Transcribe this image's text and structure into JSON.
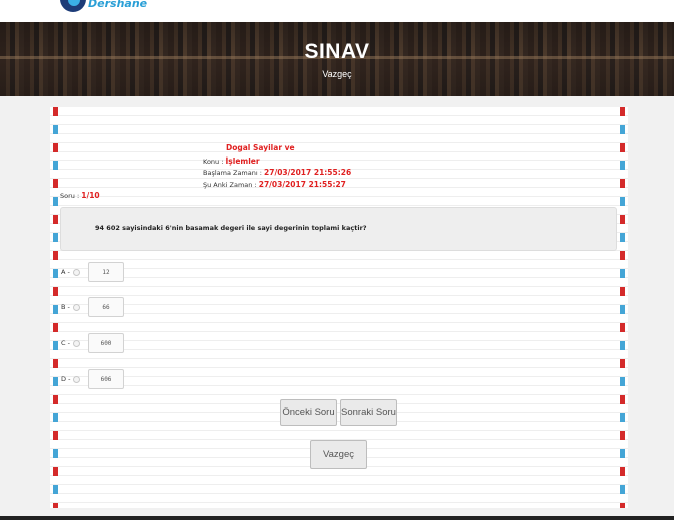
{
  "header": {
    "logo_text": "Dershane"
  },
  "hero": {
    "title": "SINAV",
    "subtitle": "Vazgeç"
  },
  "exam": {
    "topic_line": "Dogal Sayilar ve",
    "konu_label": "Konu :",
    "konu_value": "İşlemler",
    "start_label": "Başlama Zamanı :",
    "start_value": "27/03/2017 21:55:26",
    "now_label": "Şu Anki Zaman :",
    "now_value": "27/03/2017 21:55:27",
    "counter_label": "Soru :",
    "counter_value": "1/10"
  },
  "question": {
    "text": "94 602 sayisindaki 6'nin basamak degeri ile sayi degerinin toplami kaçtir?"
  },
  "options": [
    {
      "letter": "A -",
      "value": "12"
    },
    {
      "letter": "B -",
      "value": "66"
    },
    {
      "letter": "C -",
      "value": "600"
    },
    {
      "letter": "D -",
      "value": "606"
    }
  ],
  "buttons": {
    "prev": "Önceki Soru",
    "next": "Sonraki Soru",
    "cancel": "Vazgeç"
  },
  "colors": {
    "accent_red": "#e02020",
    "edge_blue": "#44a5d6",
    "edge_red": "#d42a2a"
  }
}
